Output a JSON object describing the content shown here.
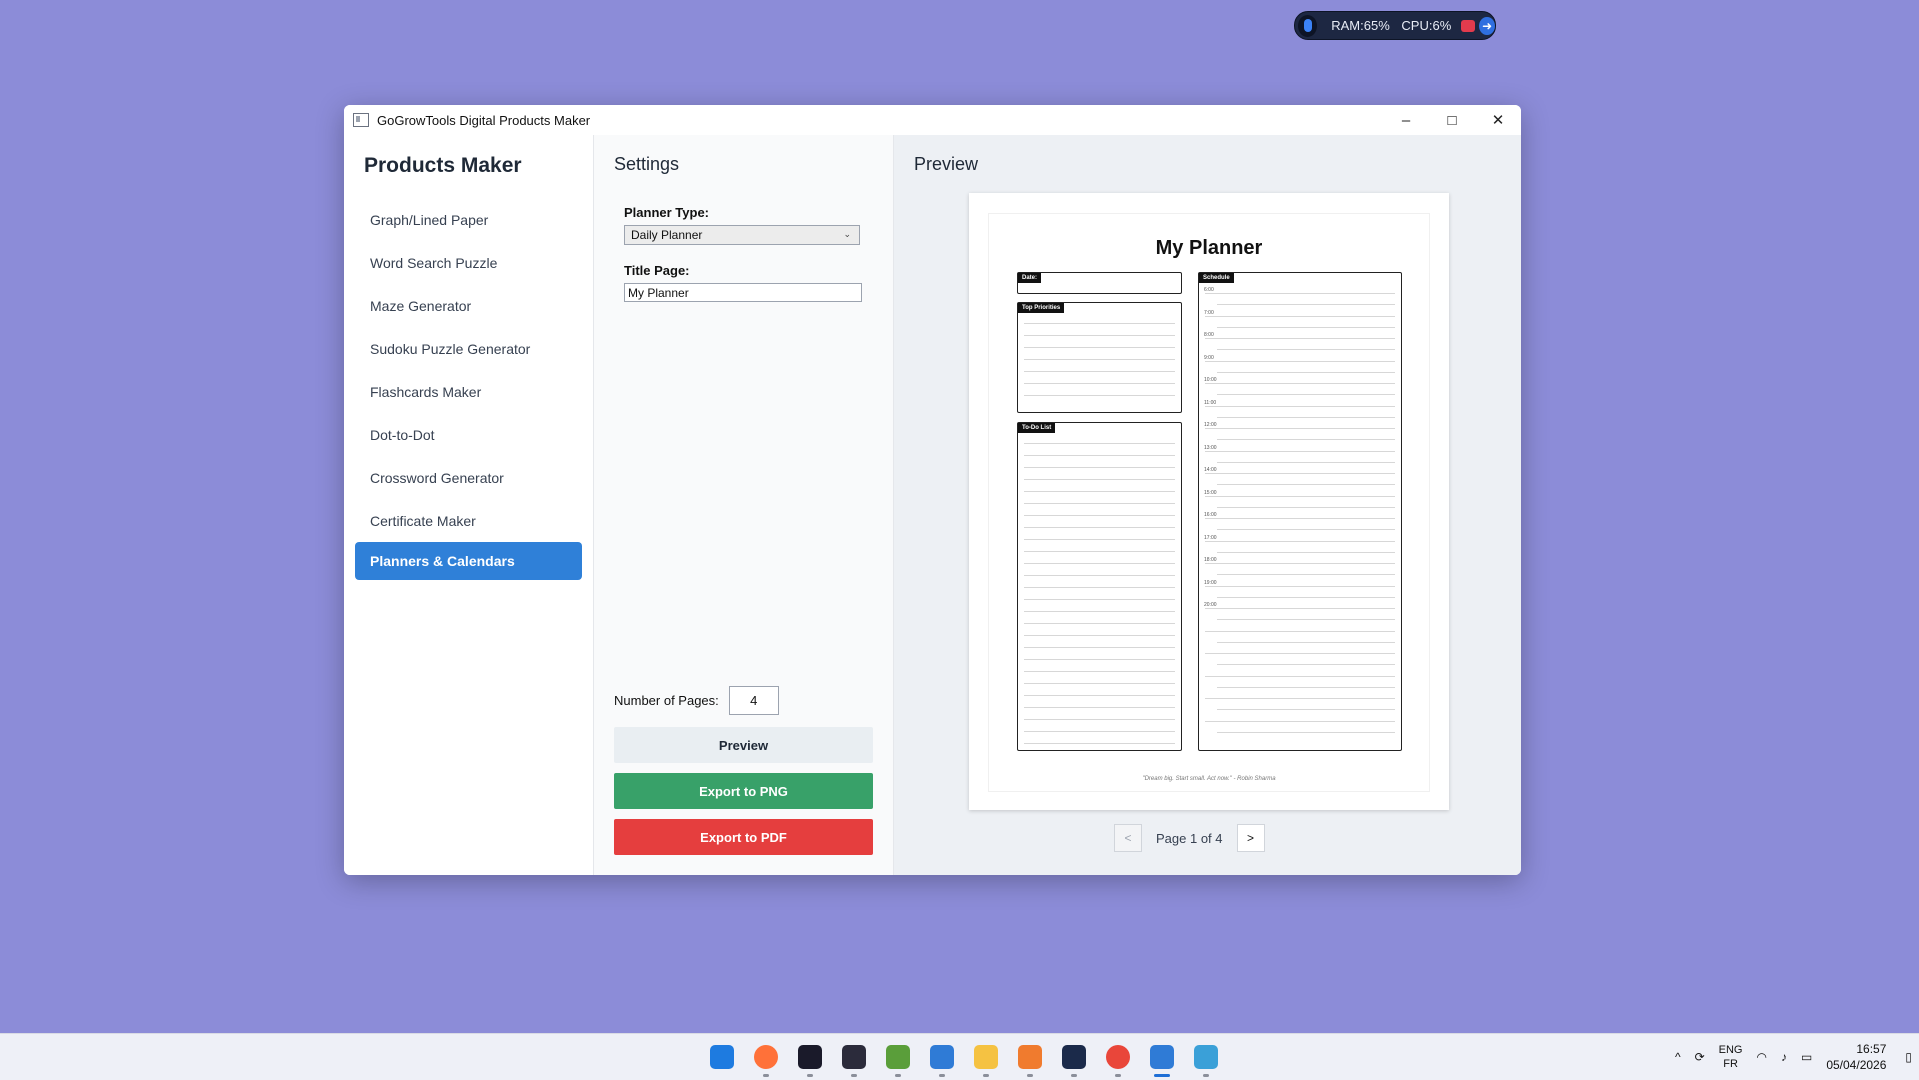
{
  "monitor": {
    "ram": "RAM:65%",
    "cpu": "CPU:6%"
  },
  "window": {
    "title": "GoGrowTools Digital Products Maker",
    "minimize": "–",
    "maximize": "□",
    "close": "✕"
  },
  "sidebar": {
    "heading": "Products Maker",
    "items": [
      {
        "label": "Graph/Lined Paper"
      },
      {
        "label": "Word Search Puzzle"
      },
      {
        "label": "Maze Generator"
      },
      {
        "label": "Sudoku Puzzle Generator"
      },
      {
        "label": "Flashcards Maker"
      },
      {
        "label": "Dot-to-Dot"
      },
      {
        "label": "Crossword Generator"
      },
      {
        "label": "Certificate Maker"
      },
      {
        "label": "Planners & Calendars",
        "active": true
      }
    ]
  },
  "settings": {
    "heading": "Settings",
    "planner_type_label": "Planner Type:",
    "planner_type_value": "Daily Planner",
    "title_page_label": "Title Page:",
    "title_page_value": "My Planner",
    "pages_label": "Number of Pages:",
    "pages_value": "4",
    "preview_button": "Preview",
    "export_png_button": "Export to PNG",
    "export_pdf_button": "Export to PDF"
  },
  "preview": {
    "heading": "Preview",
    "planner_title": "My Planner",
    "date_tag": "Date:",
    "priorities_tag": "Top Priorities",
    "todo_tag": "To-Do List",
    "schedule_tag": "Schedule",
    "times": [
      "6:00",
      "7:00",
      "8:00",
      "9:00",
      "10:00",
      "11:00",
      "12:00",
      "13:00",
      "14:00",
      "15:00",
      "16:00",
      "17:00",
      "18:00",
      "19:00",
      "20:00"
    ],
    "quote": "\"Dream big. Start small. Act now.\" - Robin Sharma",
    "prev_button": "<",
    "next_button": ">",
    "page_info": "Page 1 of 4"
  },
  "taskbar": {
    "apps": [
      {
        "name": "start-icon",
        "color": "#1e7be0"
      },
      {
        "name": "firefox-icon",
        "color": "#ff7139"
      },
      {
        "name": "app-icon",
        "color": "#1a1a2a"
      },
      {
        "name": "app-icon",
        "color": "#2b2b3b"
      },
      {
        "name": "app-icon",
        "color": "#5a9e3a"
      },
      {
        "name": "notepad-icon",
        "color": "#2f7bd6"
      },
      {
        "name": "folder-icon",
        "color": "#f5c242"
      },
      {
        "name": "app-icon",
        "color": "#f07b2e"
      },
      {
        "name": "app-icon",
        "color": "#1b2a4a"
      },
      {
        "name": "chrome-icon",
        "color": "#e9463a"
      },
      {
        "name": "app-icon",
        "color": "#2f7bd6",
        "active": true
      },
      {
        "name": "app-icon",
        "color": "#3aa0d8"
      }
    ],
    "lang_top": "ENG",
    "lang_bottom": "FR",
    "time": "16:57",
    "date": "05/04/2026"
  }
}
